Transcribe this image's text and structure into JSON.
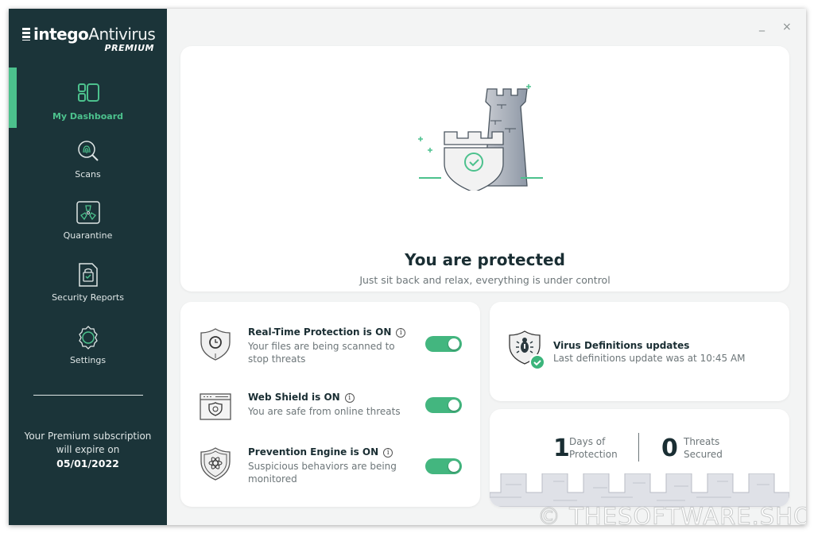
{
  "app": {
    "brand_bold": "intego",
    "brand_light": "Antivirus",
    "edition": "PREMIUM",
    "accent": "#4cc18d",
    "sidebar_bg": "#1b3439"
  },
  "window_controls": {
    "minimize": "_",
    "close": "×"
  },
  "sidebar": {
    "items": [
      {
        "label": "My Dashboard",
        "icon": "dashboard-icon",
        "active": true
      },
      {
        "label": "Scans",
        "icon": "fingerprint-search-icon",
        "active": false
      },
      {
        "label": "Quarantine",
        "icon": "biohazard-icon",
        "active": false
      },
      {
        "label": "Security Reports",
        "icon": "report-document-icon",
        "active": false
      },
      {
        "label": "Settings",
        "icon": "gear-icon",
        "active": false
      }
    ],
    "subscription": {
      "line1": "Your Premium subscription",
      "line2": "will expire on",
      "date": "05/01/2022"
    }
  },
  "hero": {
    "title": "You are protected",
    "subtitle": "Just sit back and relax, everything is under control"
  },
  "features": [
    {
      "title": "Real-Time Protection is ON",
      "description": "Your files are being scanned to stop threats",
      "icon": "clock-shield-icon",
      "enabled": true
    },
    {
      "title": "Web Shield is ON",
      "description": "You are safe from online threats",
      "icon": "web-shield-icon",
      "enabled": true
    },
    {
      "title": "Prevention Engine is ON",
      "description": "Suspicious behaviors are being monitored",
      "icon": "atom-shield-icon",
      "enabled": true
    }
  ],
  "info_glyph": "i",
  "definitions": {
    "title": "Virus Definitions updates",
    "description": "Last definitions update was at 10:45 AM"
  },
  "stats": [
    {
      "value": "1",
      "label1": "Days of",
      "label2": "Protection"
    },
    {
      "value": "0",
      "label1": "Threats",
      "label2": "Secured"
    }
  ],
  "watermark": "© THESOFTWARE.SHOP"
}
